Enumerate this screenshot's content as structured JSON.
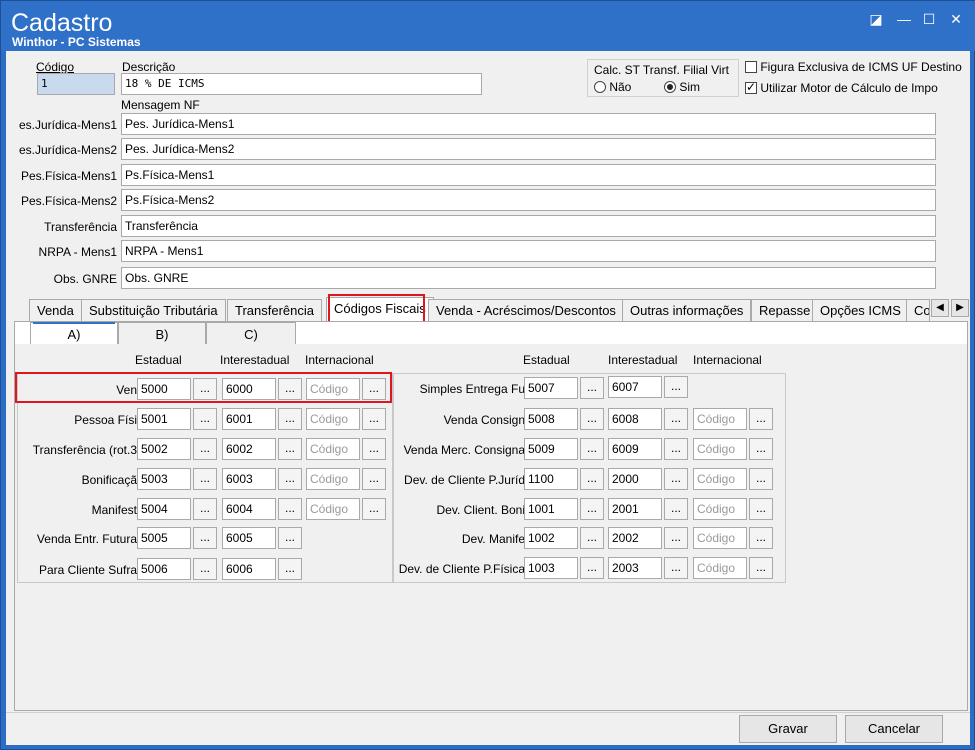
{
  "window": {
    "title": "Cadastro",
    "subtitle": "Winthor - PC Sistemas",
    "buttons": [
      "◪",
      "—",
      "☐",
      "✕"
    ]
  },
  "header": {
    "codigo_label": "Código",
    "codigo_value": "1",
    "descricao_label": "Descrição",
    "descricao_value": "18 % DE ICMS",
    "mensagem_nf_label": "Mensagem NF",
    "calc_st_label": "Calc. ST Transf. Filial Virt",
    "radio_nao": "Não",
    "radio_sim": "Sim",
    "figura_label": "Figura Exclusiva de ICMS UF Destino",
    "utilizar_label": "Utilizar Motor de Cálculo de Impo"
  },
  "messages": [
    {
      "label": "es.Jurídica-Mens1",
      "value": "Pes. Jurídica-Mens1"
    },
    {
      "label": "es.Jurídica-Mens2",
      "value": "Pes. Jurídica-Mens2"
    },
    {
      "label": "Pes.Física-Mens1",
      "value": "Ps.Física-Mens1"
    },
    {
      "label": "Pes.Física-Mens2",
      "value": "Ps.Física-Mens2"
    },
    {
      "label": "Transferência",
      "value": "Transferência"
    },
    {
      "label": "NRPA - Mens1",
      "value": "NRPA - Mens1"
    },
    {
      "label": "Obs. GNRE",
      "value": "Obs. GNRE"
    }
  ],
  "tabs": [
    "Venda",
    "Substituição Tributária",
    "Transferência",
    "Códigos Fiscais",
    "Venda - Acréscimos/Descontos",
    "Outras informações",
    "Repasse",
    "Opções ICMS",
    "Co"
  ],
  "subtabs": [
    "A)",
    "B)",
    "C)"
  ],
  "columns": {
    "estadual": "Estadual",
    "interestadual": "Interestadual",
    "internacional": "Internacional"
  },
  "dots": "...",
  "placeholder": "Código",
  "left_rows": [
    {
      "label": "Ven",
      "est": "5000",
      "inter": "6000",
      "intl": "Código"
    },
    {
      "label": "Pessoa Físi",
      "est": "5001",
      "inter": "6001",
      "intl": "Código"
    },
    {
      "label": "Transferência (rot.3",
      "est": "5002",
      "inter": "6002",
      "intl": "Código"
    },
    {
      "label": "Bonificaçã",
      "est": "5003",
      "inter": "6003",
      "intl": "Código"
    },
    {
      "label": "Manifest",
      "est": "5004",
      "inter": "6004",
      "intl": "Código"
    },
    {
      "label": "Venda Entr. Futura",
      "est": "5005",
      "inter": "6005"
    },
    {
      "label": "Para Cliente Sufra",
      "est": "5006",
      "inter": "6006"
    }
  ],
  "right_rows": [
    {
      "label": "Simples Entrega Fu",
      "est": "5007",
      "inter": "6007"
    },
    {
      "label": "Venda Consign",
      "est": "5008",
      "inter": "6008",
      "intl": "Código"
    },
    {
      "label": "Venda Merc. Consigna",
      "est": "5009",
      "inter": "6009",
      "intl": "Código"
    },
    {
      "label": "Dev. de Cliente P.Juríd",
      "est": "1100",
      "inter": "2000",
      "intl": "Código"
    },
    {
      "label": "Dev. Client. Boni",
      "est": "1001",
      "inter": "2001",
      "intl": "Código"
    },
    {
      "label": "Dev. Manife",
      "est": "1002",
      "inter": "2002",
      "intl": "Código"
    },
    {
      "label": "Dev. de Cliente P.Física",
      "est": "1003",
      "inter": "2003",
      "intl": "Código"
    }
  ],
  "footer": {
    "gravar": "Gravar",
    "cancelar": "Cancelar"
  }
}
